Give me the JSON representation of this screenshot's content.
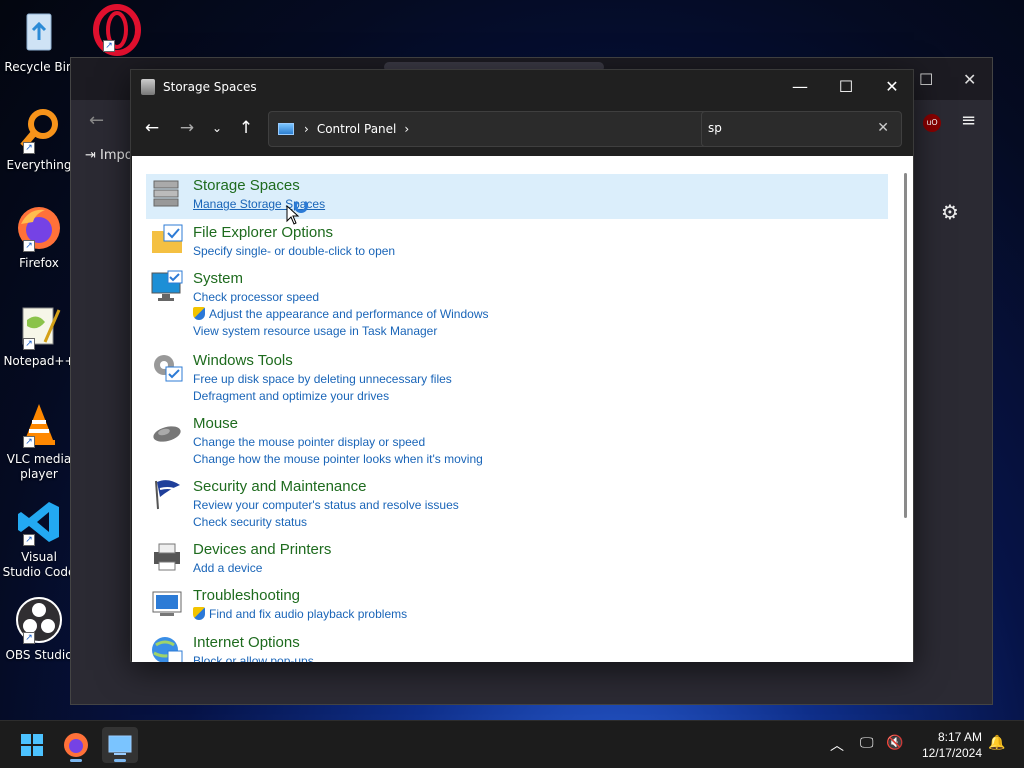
{
  "desktop": {
    "icons": [
      {
        "label": "Recycle Bin",
        "icon": "recycle-bin-icon"
      },
      {
        "label": "Everything",
        "icon": "everything-search-icon"
      },
      {
        "label": "Firefox",
        "icon": "firefox-icon"
      },
      {
        "label": "Notepad++",
        "icon": "notepadpp-icon"
      },
      {
        "label": "VLC media player",
        "icon": "vlc-icon"
      },
      {
        "label": "Visual Studio Code",
        "icon": "vscode-icon"
      },
      {
        "label": "OBS Studio",
        "icon": "obs-icon"
      }
    ]
  },
  "background_window": {
    "import_label": "Impo"
  },
  "window": {
    "title": "Storage Spaces",
    "address": {
      "crumb": "Control Panel"
    },
    "search": {
      "value": "sp"
    }
  },
  "results": [
    {
      "title": "Storage Spaces",
      "links": [
        {
          "text": "Manage Storage Spaces",
          "shield": false
        }
      ],
      "icon": "storage-spaces-icon"
    },
    {
      "title": "File Explorer Options",
      "links": [
        {
          "text": "Specify single- or double-click to open",
          "shield": false
        }
      ],
      "icon": "folder-options-icon"
    },
    {
      "title": "System",
      "links": [
        {
          "text": "Check processor speed",
          "shield": false
        },
        {
          "text": "Adjust the appearance and performance of Windows",
          "shield": true
        },
        {
          "text": "View system resource usage in Task Manager",
          "shield": false
        }
      ],
      "icon": "system-icon"
    },
    {
      "title": "Windows Tools",
      "links": [
        {
          "text": "Free up disk space by deleting unnecessary files",
          "shield": false
        },
        {
          "text": "Defragment and optimize your drives",
          "shield": false
        }
      ],
      "icon": "windows-tools-icon"
    },
    {
      "title": "Mouse",
      "links": [
        {
          "text": "Change the mouse pointer display or speed",
          "shield": false
        },
        {
          "text": "Change how the mouse pointer looks when it's moving",
          "shield": false
        }
      ],
      "icon": "mouse-icon"
    },
    {
      "title": "Security and Maintenance",
      "links": [
        {
          "text": "Review your computer's status and resolve issues",
          "shield": false
        },
        {
          "text": "Check security status",
          "shield": false
        }
      ],
      "icon": "security-flag-icon"
    },
    {
      "title": "Devices and Printers",
      "links": [
        {
          "text": "Add a device",
          "shield": false
        }
      ],
      "icon": "printer-icon"
    },
    {
      "title": "Troubleshooting",
      "links": [
        {
          "text": "Find and fix audio playback problems",
          "shield": true
        }
      ],
      "icon": "troubleshooting-icon"
    },
    {
      "title": "Internet Options",
      "links": [
        {
          "text": "Block or allow pop-ups",
          "shield": false
        }
      ],
      "icon": "internet-options-icon"
    }
  ],
  "taskbar": {
    "time": "8:17 AM",
    "date": "12/17/2024"
  },
  "colors": {
    "result_title": "#1e6b1e",
    "result_link": "#1a65b8",
    "highlight": "#dbeefb"
  }
}
